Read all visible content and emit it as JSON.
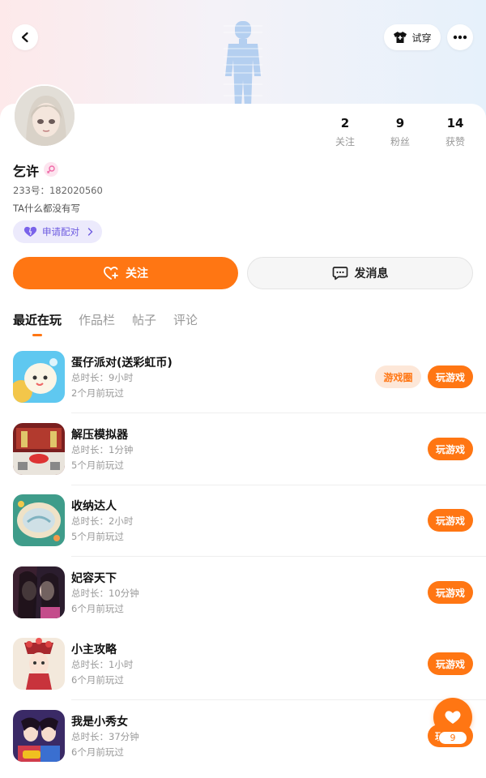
{
  "header": {
    "try_on_label": "试穿"
  },
  "profile": {
    "username": "乞许",
    "uid_text": "233号：182020560",
    "bio": "TA什么都没有写",
    "pair_label": "申请配对",
    "stats": [
      {
        "value": "2",
        "label": "关注"
      },
      {
        "value": "9",
        "label": "粉丝"
      },
      {
        "value": "14",
        "label": "获赞"
      }
    ]
  },
  "actions": {
    "follow_label": "关注",
    "message_label": "发消息"
  },
  "tabs": [
    "最近在玩",
    "作品栏",
    "帖子",
    "评论"
  ],
  "games": [
    {
      "name": "蛋仔派对(送彩虹币)",
      "duration": "总时长：9小时",
      "last_played": "2个月前玩过",
      "circle_label": "游戏圈",
      "play_label": "玩游戏"
    },
    {
      "name": "解压模拟器",
      "duration": "总时长：1分钟",
      "last_played": "5个月前玩过",
      "play_label": "玩游戏"
    },
    {
      "name": "收纳达人",
      "duration": "总时长：2小时",
      "last_played": "5个月前玩过",
      "play_label": "玩游戏"
    },
    {
      "name": "妃容天下",
      "duration": "总时长：10分钟",
      "last_played": "6个月前玩过",
      "play_label": "玩游戏"
    },
    {
      "name": "小主攻略",
      "duration": "总时长：1小时",
      "last_played": "6个月前玩过",
      "play_label": "玩游戏"
    },
    {
      "name": "我是小秀女",
      "duration": "总时长：37分钟",
      "last_played": "6个月前玩过",
      "play_label": "玩"
    }
  ],
  "like": {
    "count": "9"
  },
  "colors": {
    "accent": "#ff7613",
    "pair_chip_bg": "#eceafc",
    "pair_chip_text": "#6d5be0"
  }
}
